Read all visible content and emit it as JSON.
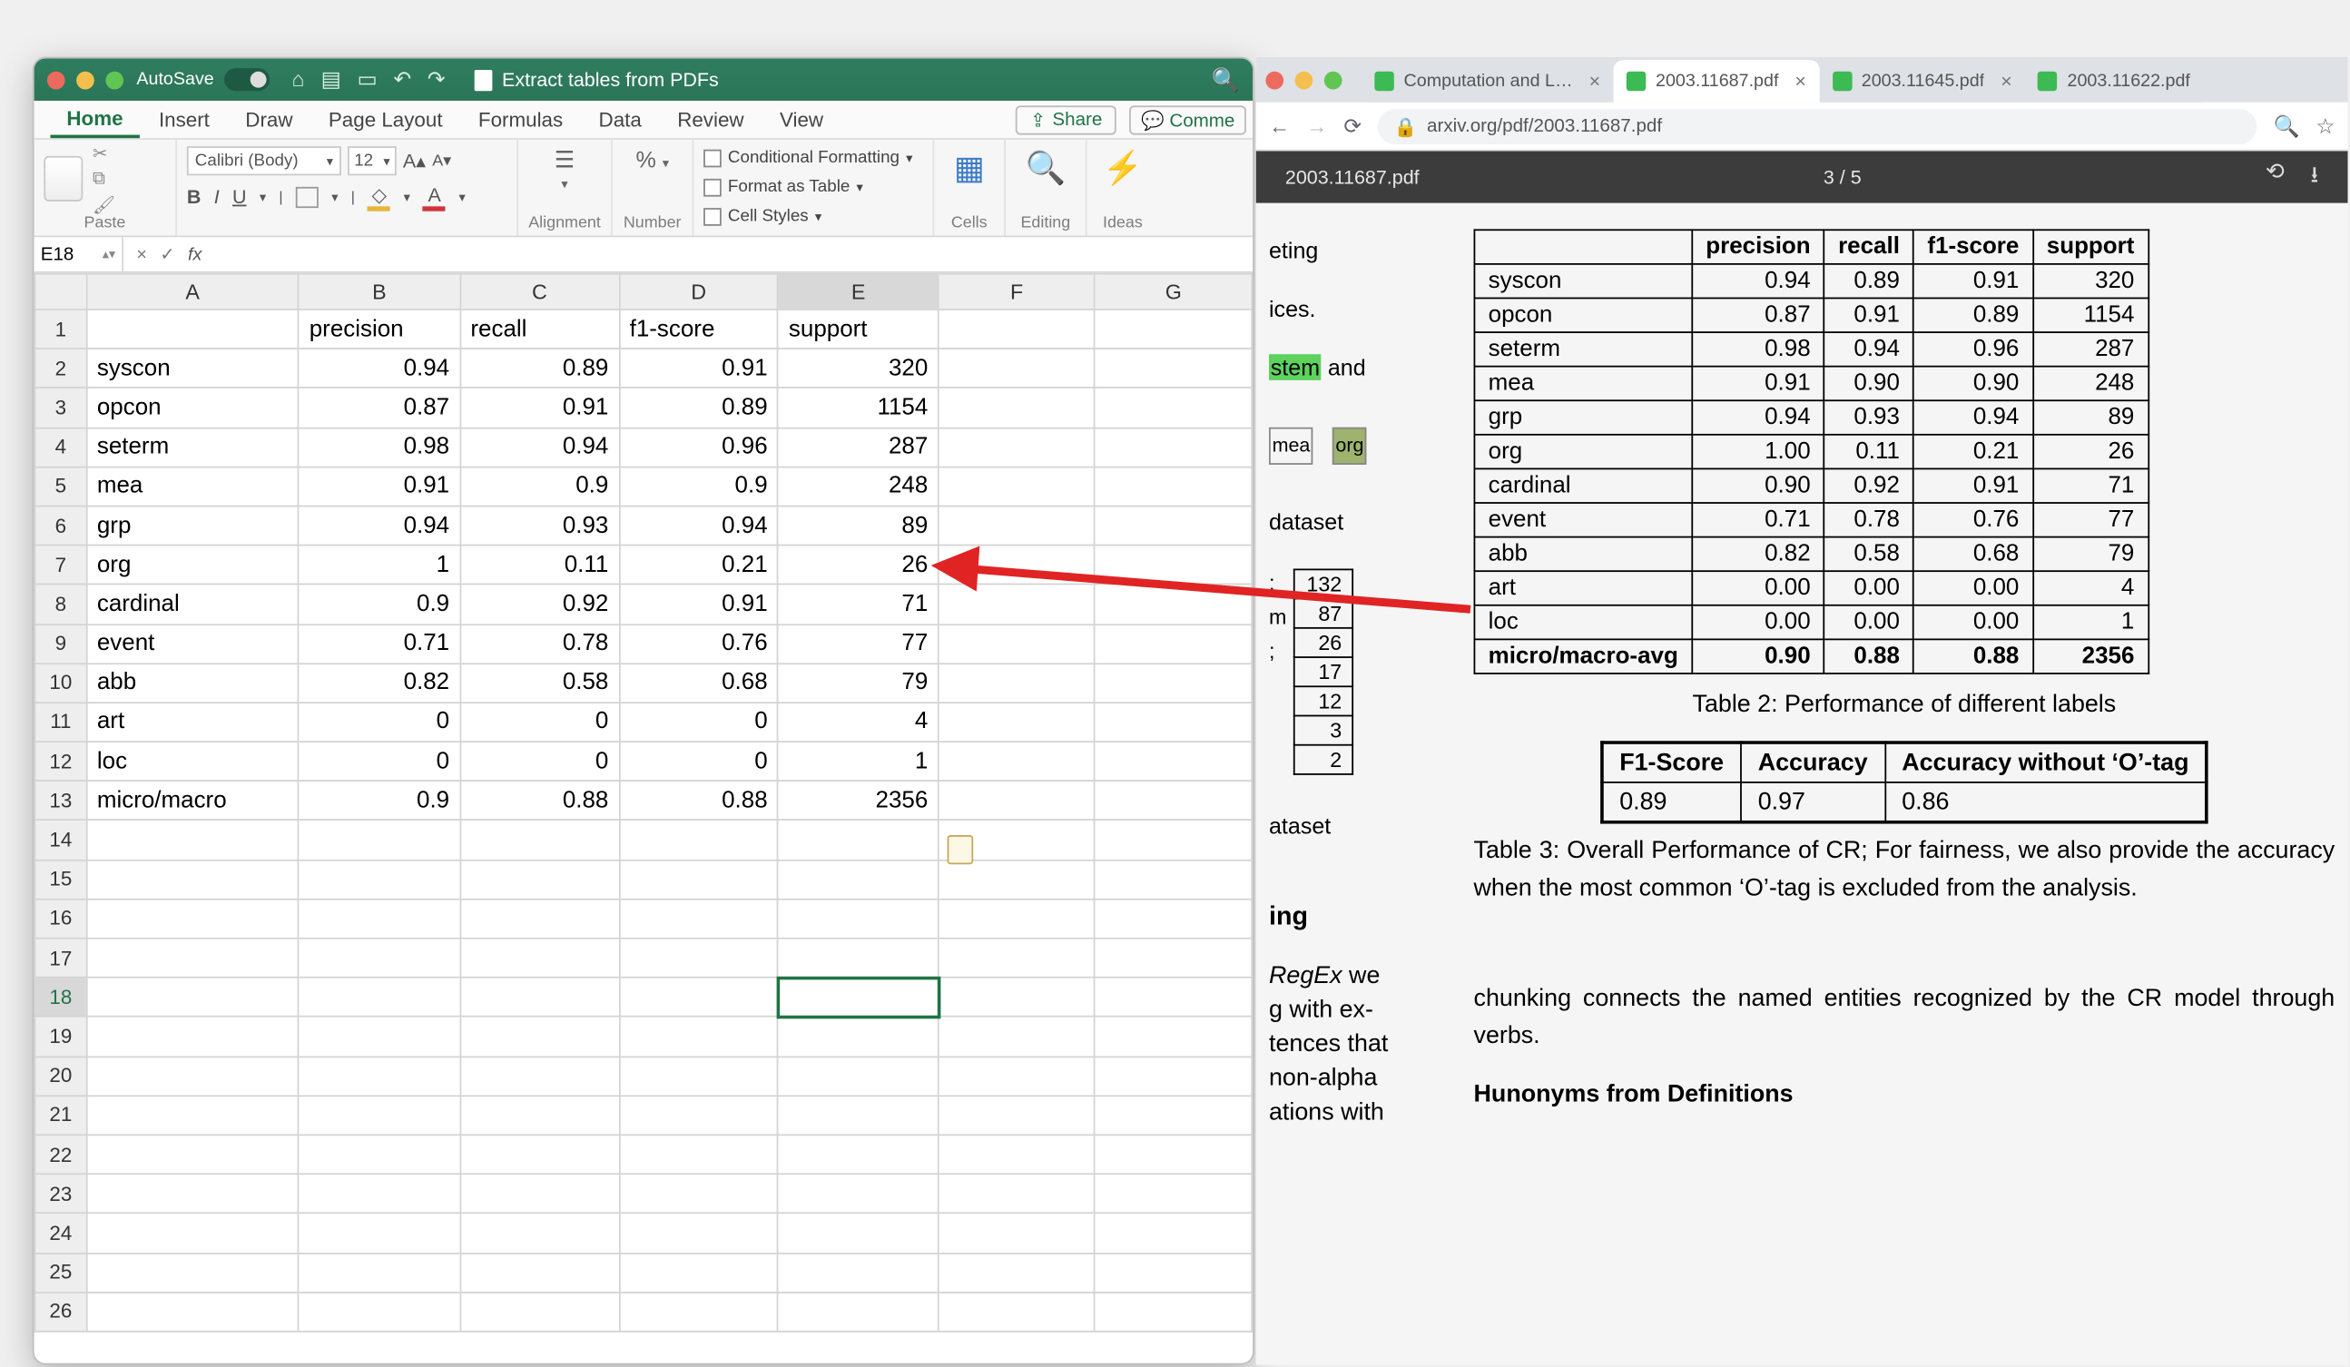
{
  "excel": {
    "titlebar": {
      "autosave": "AutoSave",
      "docname": "Extract tables from PDFs"
    },
    "menus": [
      "Home",
      "Insert",
      "Draw",
      "Page Layout",
      "Formulas",
      "Data",
      "Review",
      "View"
    ],
    "share": "Share",
    "comments": "Comme",
    "ribbon": {
      "pasteLbl": "Paste",
      "fontName": "Calibri (Body)",
      "fontSize": "12",
      "alignLbl": "Alignment",
      "numberLbl": "Number",
      "cf": "Conditional Formatting",
      "fat": "Format as Table",
      "cs": "Cell Styles",
      "cells": "Cells",
      "editing": "Editing",
      "ideas": "Ideas"
    },
    "cellref": "E18",
    "cols": [
      "A",
      "B",
      "C",
      "D",
      "E",
      "F",
      "G"
    ],
    "headers": [
      "",
      "precision",
      "recall",
      "f1-score",
      "support"
    ],
    "rows": [
      {
        "label": "syscon",
        "v": [
          0.94,
          0.89,
          0.91,
          320
        ]
      },
      {
        "label": "opcon",
        "v": [
          0.87,
          0.91,
          0.89,
          1154
        ]
      },
      {
        "label": "seterm",
        "v": [
          0.98,
          0.94,
          0.96,
          287
        ]
      },
      {
        "label": "mea",
        "v": [
          0.91,
          0.9,
          0.9,
          248
        ]
      },
      {
        "label": "grp",
        "v": [
          0.94,
          0.93,
          0.94,
          89
        ]
      },
      {
        "label": "org",
        "v": [
          1,
          0.11,
          0.21,
          26
        ]
      },
      {
        "label": "cardinal",
        "v": [
          0.9,
          0.92,
          0.91,
          71
        ]
      },
      {
        "label": "event",
        "v": [
          0.71,
          0.78,
          0.76,
          77
        ]
      },
      {
        "label": "abb",
        "v": [
          0.82,
          0.58,
          0.68,
          79
        ]
      },
      {
        "label": "art",
        "v": [
          0,
          0,
          0,
          4
        ]
      },
      {
        "label": "loc",
        "v": [
          0,
          0,
          0,
          1
        ]
      },
      {
        "label": "micro/macro",
        "v": [
          0.9,
          0.88,
          0.88,
          2356
        ]
      }
    ],
    "blankRows": [
      14,
      15,
      16,
      17,
      18,
      19,
      20,
      21,
      22,
      23,
      24,
      25,
      26
    ]
  },
  "browser": {
    "tabs": [
      {
        "t": "Computation and Lan…",
        "active": false,
        "close": true
      },
      {
        "t": "2003.11687.pdf",
        "active": true,
        "close": true
      },
      {
        "t": "2003.11645.pdf",
        "active": false,
        "close": true
      },
      {
        "t": "2003.11622.pdf",
        "active": false,
        "close": false
      }
    ],
    "url": "arxiv.org/pdf/2003.11687.pdf",
    "pdfname": "2003.11687.pdf",
    "pages": "3 / 5",
    "leftfrags": {
      "a": "eting",
      "b": "ices.",
      "c1": "stem",
      "c2": " and",
      "d": "mea",
      "e": "org",
      "f": "dataset",
      "g": "m",
      "h": "ataset",
      "i": "ing",
      "reg": "RegEx",
      "reg2": " we",
      "j": "g with ex-",
      "k": "tences that",
      "l": "non-alpha",
      "m": "ations with",
      "sv": [
        132,
        87,
        26,
        17,
        12,
        3,
        2
      ]
    },
    "table2": {
      "head": [
        "",
        "precision",
        "recall",
        "f1-score",
        "support"
      ],
      "rows": [
        [
          "syscon",
          "0.94",
          "0.89",
          "0.91",
          "320"
        ],
        [
          "opcon",
          "0.87",
          "0.91",
          "0.89",
          "1154"
        ],
        [
          "seterm",
          "0.98",
          "0.94",
          "0.96",
          "287"
        ],
        [
          "mea",
          "0.91",
          "0.90",
          "0.90",
          "248"
        ],
        [
          "grp",
          "0.94",
          "0.93",
          "0.94",
          "89"
        ],
        [
          "org",
          "1.00",
          "0.11",
          "0.21",
          "26"
        ],
        [
          "cardinal",
          "0.90",
          "0.92",
          "0.91",
          "71"
        ],
        [
          "event",
          "0.71",
          "0.78",
          "0.76",
          "77"
        ],
        [
          "abb",
          "0.82",
          "0.58",
          "0.68",
          "79"
        ],
        [
          "art",
          "0.00",
          "0.00",
          "0.00",
          "4"
        ],
        [
          "loc",
          "0.00",
          "0.00",
          "0.00",
          "1"
        ],
        [
          "micro/macro-avg",
          "0.90",
          "0.88",
          "0.88",
          "2356"
        ]
      ],
      "caption": "Table 2: Performance of different labels"
    },
    "table3": {
      "head": [
        "F1-Score",
        "Accuracy",
        "Accuracy without ‘O’-tag"
      ],
      "row": [
        "0.89",
        "0.97",
        "0.86"
      ],
      "caption": "Table 3: Overall Performance of CR; For fairness, we also provide the accuracy when the most common ‘O’-tag is excluded from the analysis."
    },
    "chunk": "chunking connects the named entities recognized by the CR model through verbs.",
    "hyp": "Hunonyms from Definitions"
  },
  "chart_data": {
    "type": "table",
    "title": "Table 2: Performance of different labels",
    "columns": [
      "precision",
      "recall",
      "f1-score",
      "support"
    ],
    "categories": [
      "syscon",
      "opcon",
      "seterm",
      "mea",
      "grp",
      "org",
      "cardinal",
      "event",
      "abb",
      "art",
      "loc",
      "micro/macro-avg"
    ],
    "series": [
      {
        "name": "precision",
        "values": [
          0.94,
          0.87,
          0.98,
          0.91,
          0.94,
          1.0,
          0.9,
          0.71,
          0.82,
          0.0,
          0.0,
          0.9
        ]
      },
      {
        "name": "recall",
        "values": [
          0.89,
          0.91,
          0.94,
          0.9,
          0.93,
          0.11,
          0.92,
          0.78,
          0.58,
          0.0,
          0.0,
          0.88
        ]
      },
      {
        "name": "f1-score",
        "values": [
          0.91,
          0.89,
          0.96,
          0.9,
          0.94,
          0.21,
          0.91,
          0.76,
          0.68,
          0.0,
          0.0,
          0.88
        ]
      },
      {
        "name": "support",
        "values": [
          320,
          1154,
          287,
          248,
          89,
          26,
          71,
          77,
          79,
          4,
          1,
          2356
        ]
      }
    ]
  }
}
